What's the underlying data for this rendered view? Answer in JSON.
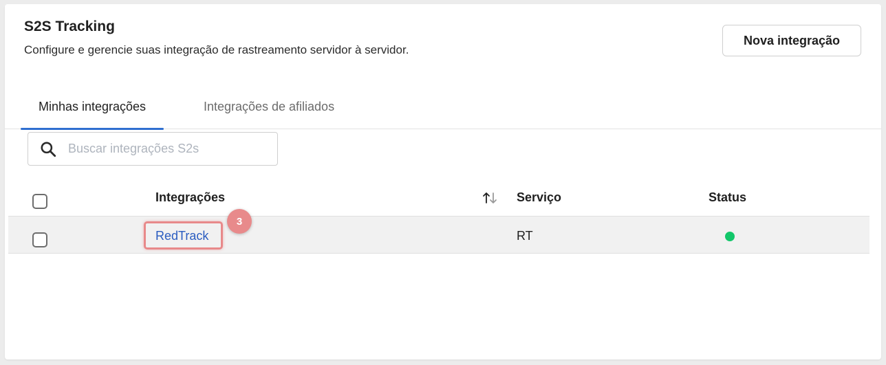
{
  "header": {
    "title": "S2S Tracking",
    "subtitle": "Configure e gerencie suas integração de rastreamento servidor à servidor.",
    "new_button_label": "Nova integração"
  },
  "tabs": [
    {
      "label": "Minhas integrações",
      "active": true
    },
    {
      "label": "Integrações de afiliados",
      "active": false
    }
  ],
  "search": {
    "placeholder": "Buscar integrações S2s",
    "value": "",
    "icon": "search-icon"
  },
  "table": {
    "columns": [
      "Integrações",
      "Serviço",
      "Status"
    ],
    "sort_icon": "sort-arrows-icon",
    "rows": [
      {
        "name": "RedTrack",
        "service": "RT",
        "status": "active",
        "status_color": "#13c76a"
      }
    ]
  },
  "annotation": {
    "step_number": "3",
    "color": "#e88a8b"
  },
  "colors": {
    "accent": "#2f6fd0",
    "link": "#2a5cc0"
  }
}
